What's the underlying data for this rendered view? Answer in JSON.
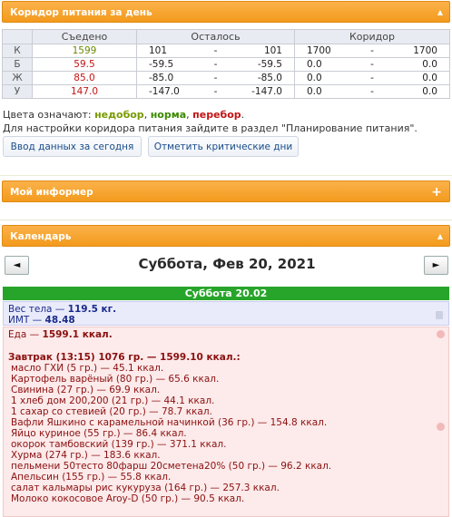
{
  "corridor": {
    "title": "Коридор питания за день",
    "toggle": "▲",
    "headers": [
      "",
      "Съедено",
      "Осталось",
      "Коридор"
    ],
    "rows": [
      {
        "label": "К",
        "eaten": "1599",
        "eaten_color": "olive",
        "left_a": "101",
        "left_b": "101",
        "corr_a": "1700",
        "corr_b": "1700"
      },
      {
        "label": "Б",
        "eaten": "59.5",
        "eaten_color": "red",
        "left_a": "-59.5",
        "left_b": "-59.5",
        "corr_a": "0.0",
        "corr_b": "0.0"
      },
      {
        "label": "Ж",
        "eaten": "85.0",
        "eaten_color": "red",
        "left_a": "-85.0",
        "left_b": "-85.0",
        "corr_a": "0.0",
        "corr_b": "0.0"
      },
      {
        "label": "У",
        "eaten": "147.0",
        "eaten_color": "red",
        "left_a": "-147.0",
        "left_b": "-147.0",
        "corr_a": "0.0",
        "corr_b": "0.0"
      }
    ],
    "dash": "-",
    "legend_prefix": "Цвета означают: ",
    "legend_under": "недобор",
    "legend_norm": "норма",
    "legend_over": "перебор",
    "legend_sep": ", ",
    "legend_end": ".",
    "note": "Для настройки коридора питания зайдите в раздел \"Планирование питания\".",
    "btn_input": "Ввод данных за сегодня",
    "btn_critical": "Отметить критические дни"
  },
  "informer": {
    "title": "Мой информер",
    "toggle": "+"
  },
  "calendar": {
    "title": "Календарь",
    "toggle": "▲",
    "prev": "◄",
    "next": "►",
    "date": "Суббота, Фев 20, 2021",
    "day_label": "Суббота 20.02",
    "weight_label": "Вес тела — ",
    "weight_value": "119.5 кг.",
    "bmi_label": "ИМТ — ",
    "bmi_value": "48.48",
    "food_label": "Еда — ",
    "food_value": "1599.1 ккал.",
    "meal_title": "Завтрак (13:15) 1076 гр. — 1599.10 ккал.:",
    "items": [
      "масло ГХИ (5 гр.) — 45.1 ккал.",
      "Картофель варёный (80 гр.) — 65.6 ккал.",
      "Свинина (27 гр.) — 69.9 ккал.",
      "1 хлеб дом 200,200 (21 гр.) — 44.1 ккал.",
      "1 сахар со стевией (20 гр.) — 78.7 ккал.",
      "Вафли Яшкино с карамельной начинкой (36 гр.) — 154.8 ккал.",
      "Яйцо куриное (55 гр.) — 86.4 ккал.",
      "окорок тамбовский (139 гр.) — 371.1 ккал.",
      "Хурма (274 гр.) — 183.6 ккал.",
      "пельмени 50тесто 80фарш 20сметена20% (50 гр.) — 96.2 ккал.",
      "Апельсин (155 гр.) — 55.8 ккал.",
      "салат кальмары рис кукуруза (164 гр.) — 257.3 ккал.",
      "Молоко кокосовое Aroy-D (50 гр.) — 90.5 ккал."
    ]
  }
}
